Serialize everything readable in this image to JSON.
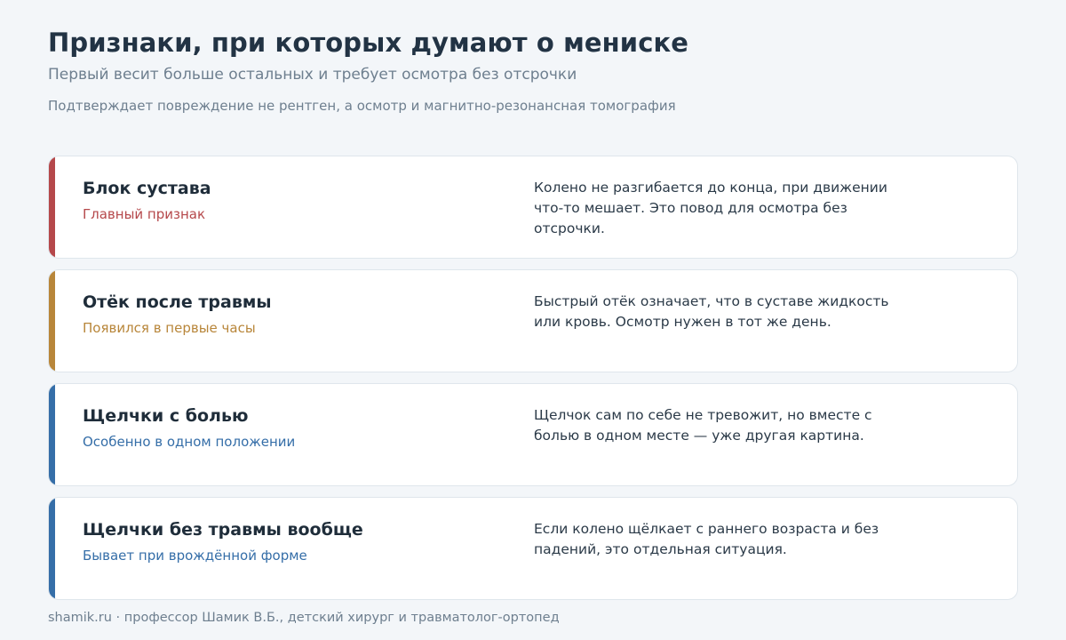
{
  "header": {
    "title": "Признаки, при которых думают о мениске",
    "subtitle": "Первый весит больше остальных и требует осмотра без отсрочки",
    "note": "Подтверждает повреждение не рентген, а осмотр и магнитно-резонансная томография"
  },
  "cards": [
    {
      "name": "Блок сустава",
      "tag": "Главный признак",
      "description": "Колено не разгибается до конца, при движении что-то мешает. Это повод для осмотра без отсрочки.",
      "accent_color": "#b5484b"
    },
    {
      "name": "Отёк после травмы",
      "tag": "Появился в первые часы",
      "description": "Быстрый отёк означает, что в суставе жидкость или кровь. Осмотр нужен в тот же день.",
      "accent_color": "#b8863a"
    },
    {
      "name": "Щелчки с болью",
      "tag": "Особенно в одном положении",
      "description": "Щелчок сам по себе не тревожит, но вместе с болью в одном месте — уже другая картина.",
      "accent_color": "#356ea8"
    },
    {
      "name": "Щелчки без травмы вообще",
      "tag": "Бывает при врождённой форме",
      "description": "Если колено щёлкает с раннего возраста и без падений, это отдельная ситуация.",
      "accent_color": "#356ea8"
    }
  ],
  "footer": {
    "text": "shamik.ru · профессор Шамик В.Б., детский хирург и травматолог-ортопед"
  }
}
